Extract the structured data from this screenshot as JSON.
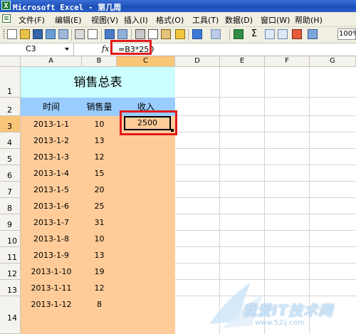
{
  "window": {
    "title": "Microsoft Excel - 第几周"
  },
  "menu": [
    "文件(F)",
    "编辑(E)",
    "视图(V)",
    "插入(I)",
    "格式(O)",
    "工具(T)",
    "数据(D)",
    "窗口(W)",
    "帮助(H)"
  ],
  "toolbar": {
    "zoom": "100%"
  },
  "formula_bar": {
    "name_box": "C3",
    "fx_label": "fx",
    "formula": "=B3*250"
  },
  "columns": [
    "A",
    "B",
    "C",
    "D",
    "E",
    "F",
    "G"
  ],
  "rows": [
    "1",
    "2",
    "3",
    "4",
    "5",
    "6",
    "7",
    "8",
    "9",
    "10",
    "11",
    "12",
    "13",
    "14"
  ],
  "sheet": {
    "title": "销售总表",
    "headers": {
      "date": "时间",
      "qty": "销售量",
      "revenue": "收入"
    },
    "data": [
      {
        "date": "2013-1-1",
        "qty": "10"
      },
      {
        "date": "2013-1-2",
        "qty": "13"
      },
      {
        "date": "2013-1-3",
        "qty": "12"
      },
      {
        "date": "2013-1-4",
        "qty": "15"
      },
      {
        "date": "2013-1-5",
        "qty": "20"
      },
      {
        "date": "2013-1-6",
        "qty": "25"
      },
      {
        "date": "2013-1-7",
        "qty": "31"
      },
      {
        "date": "2013-1-8",
        "qty": "10"
      },
      {
        "date": "2013-1-9",
        "qty": "13"
      },
      {
        "date": "2013-1-10",
        "qty": "19"
      },
      {
        "date": "2013-1-11",
        "qty": "12"
      },
      {
        "date": "2013-1-12",
        "qty": "8"
      }
    ],
    "c3_value": "2500"
  },
  "watermark": {
    "title": "我爱IT技术网",
    "url": "www.52ij.com"
  },
  "colors": {
    "title_fill": "#ccffff",
    "header_fill": "#99ccff",
    "data_fill": "#ffcc99",
    "highlight": "#e11a1a"
  }
}
